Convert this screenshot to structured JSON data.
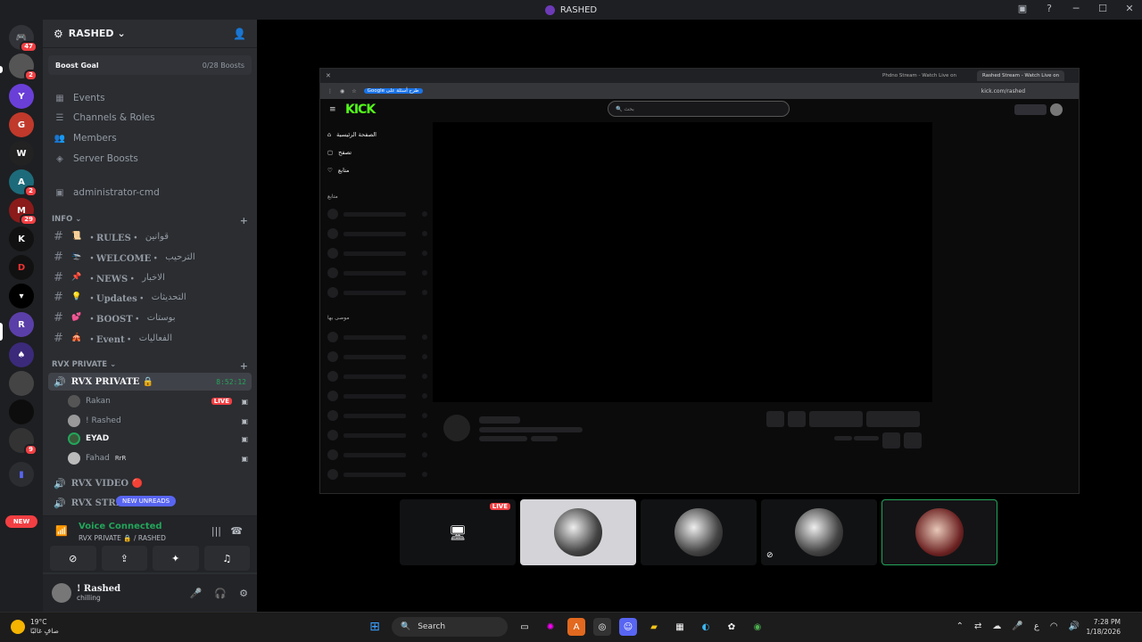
{
  "window": {
    "title": "RASHED"
  },
  "guild_badges": [
    "47",
    "2",
    "",
    "",
    "",
    "2",
    "29",
    "",
    "",
    "",
    "",
    "",
    "",
    "9"
  ],
  "new_pill": "NEW",
  "server": {
    "name": "RASHED",
    "boost_goal": "Boost Goal",
    "boost_count": "0/28 Boosts"
  },
  "nav": [
    "Events",
    "Channels & Roles",
    "Members",
    "Server Boosts",
    "administrator-cmd"
  ],
  "categories": {
    "info": "INFO",
    "rvx_private": "RVX PRIVATE"
  },
  "channels": [
    {
      "emoji": "📜",
      "name": "・RULES・",
      "ar": "قوانين"
    },
    {
      "emoji": "🛬",
      "name": "・WELCOME・",
      "ar": "الترحيب"
    },
    {
      "emoji": "📌",
      "name": "・NEWS・",
      "ar": "الاخبار"
    },
    {
      "emoji": "💡",
      "name": "・Updates・",
      "ar": "التحديثات"
    },
    {
      "emoji": "💕",
      "name": "・BOOST・",
      "ar": "بوستات"
    },
    {
      "emoji": "🎪",
      "name": "・Event・",
      "ar": "الفعاليات"
    }
  ],
  "voice": {
    "active": "RVX PRIVATE 🔒",
    "timer": "8:52:12",
    "video": "RVX VIDEO 🔴",
    "stream": "RVX STRE...",
    "new_unreads": "NEW UNREADS"
  },
  "users": [
    {
      "name": "Rakan",
      "live": "LIVE"
    },
    {
      "name": "! Rashed"
    },
    {
      "name": "EYAD"
    },
    {
      "name": "Fahad",
      "tag": "RrR"
    }
  ],
  "voice_connected": {
    "status": "Voice Connected",
    "where": "RVX PRIVATE 🔒 / RASHED"
  },
  "me": {
    "name": "! Rashed",
    "status": "chilling"
  },
  "browser": {
    "tabs": [
      "Rashed Stream - Watch Live on",
      "Phdno Stream - Watch Live on"
    ],
    "google_btn": "Google طرح أسئلة على",
    "address": "kick.com/rashed",
    "search_placeholder": "بحث",
    "nav": [
      "الصفحة الرئيسية",
      "تصفح",
      "متابع"
    ],
    "following": "متابع",
    "recommended": "موصى بها"
  },
  "tiles": {
    "live": "LIVE"
  },
  "taskbar": {
    "temp": "19°C",
    "weather": "صافٍ غالبًا",
    "search": "Search",
    "time": "7:28 PM",
    "date": "1/18/2026",
    "lang": "ع"
  }
}
